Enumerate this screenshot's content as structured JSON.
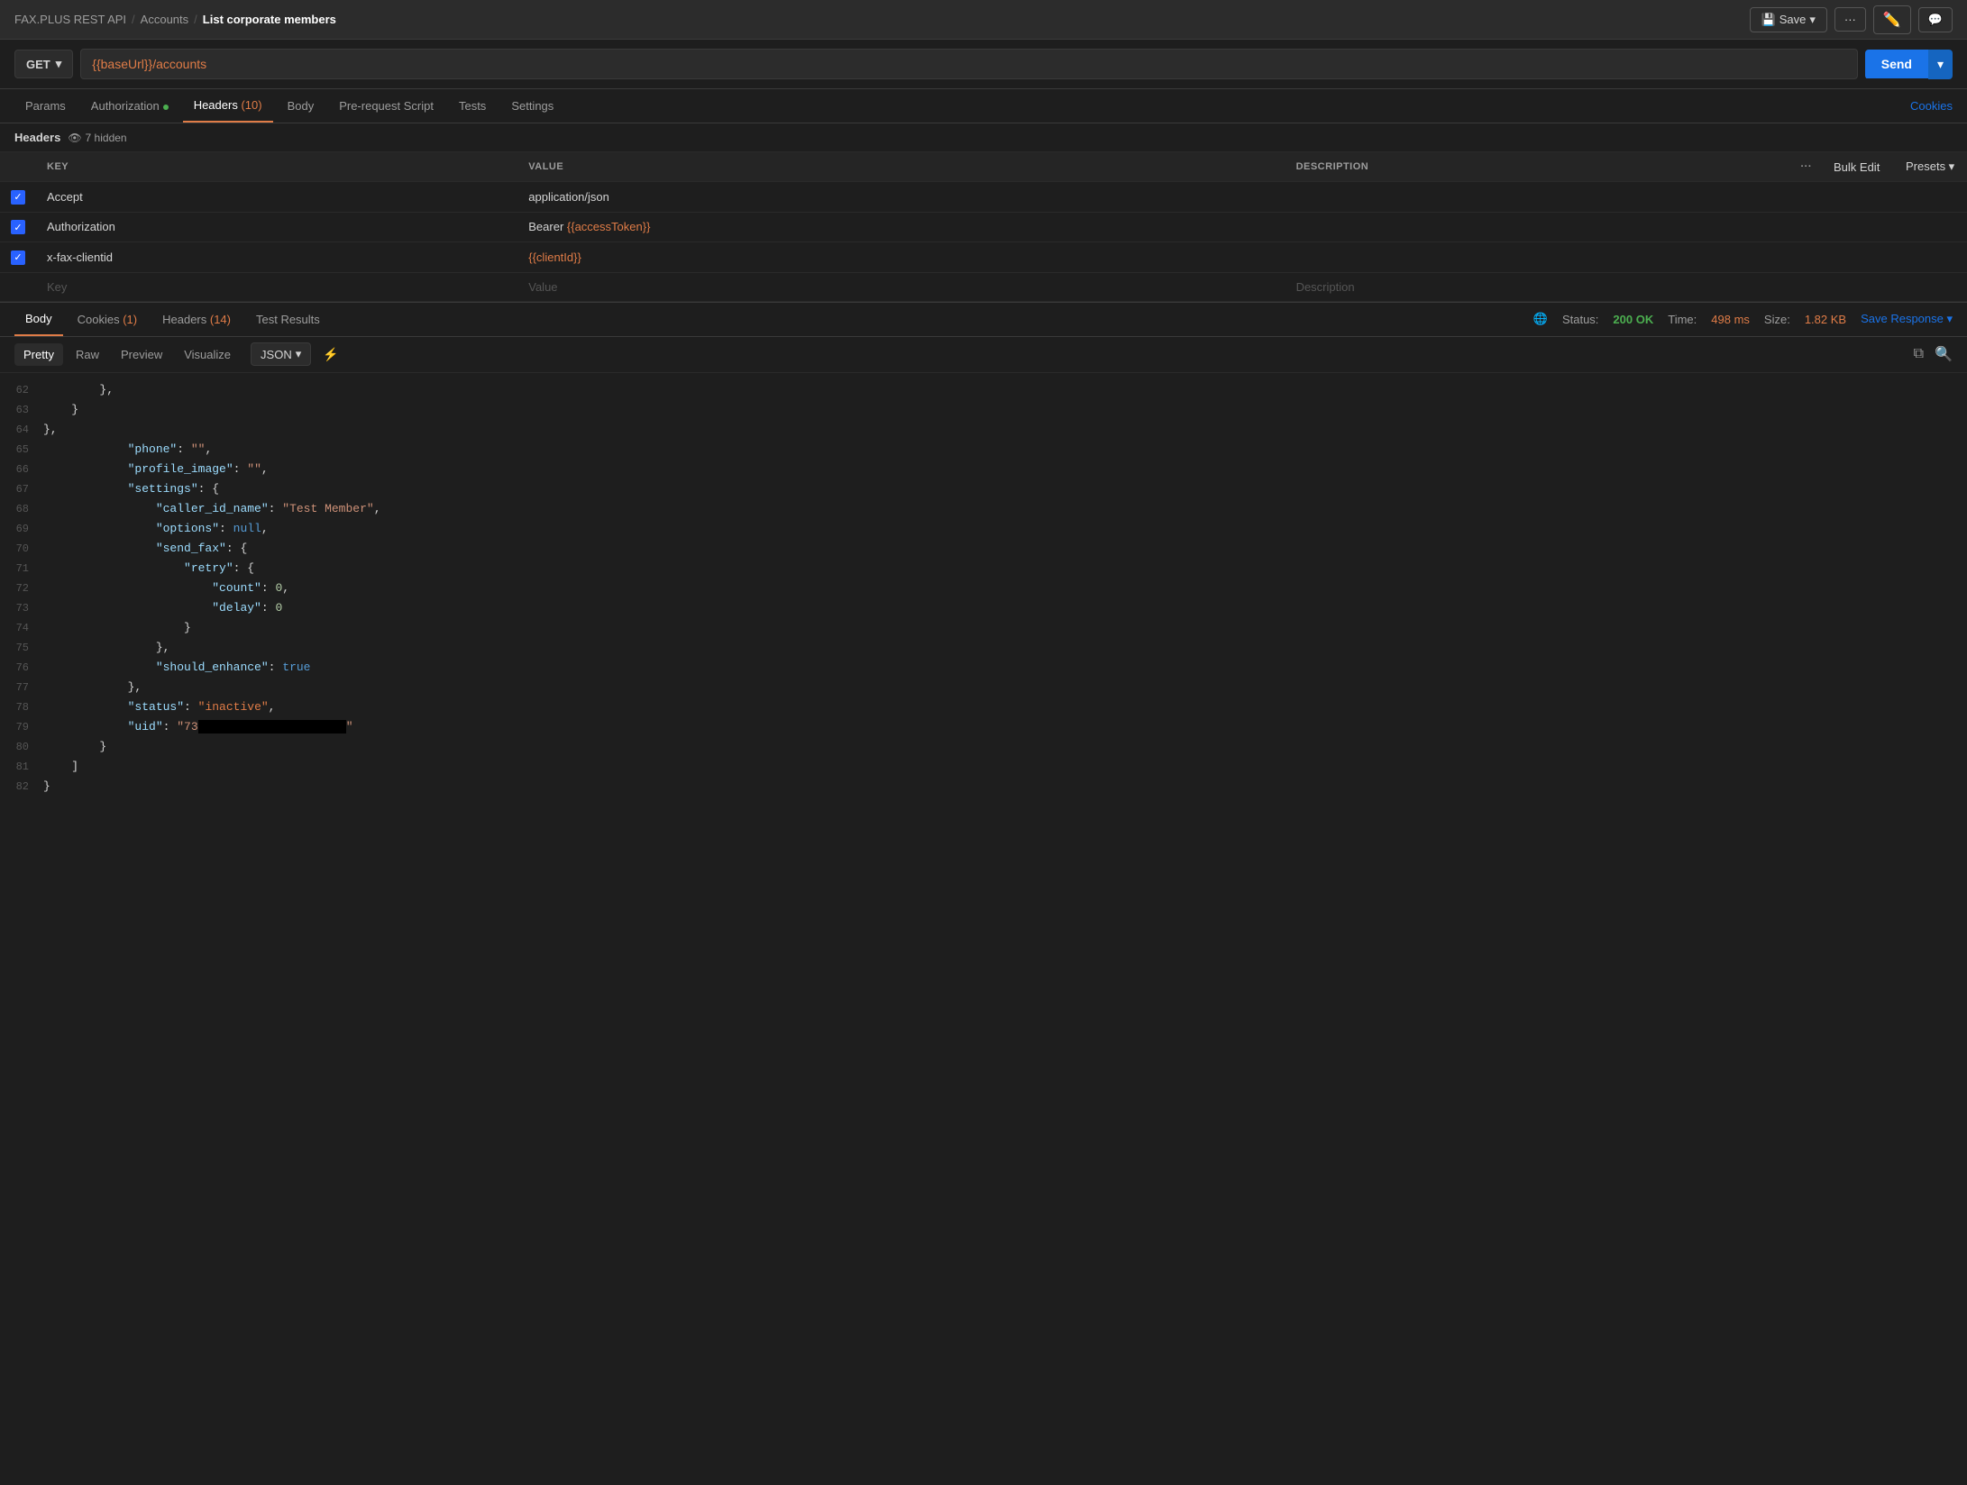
{
  "topbar": {
    "breadcrumb": [
      "FAX.PLUS REST API",
      "Accounts",
      "List corporate members"
    ],
    "save_label": "Save",
    "more_label": "···"
  },
  "urlbar": {
    "method": "GET",
    "url": "{{baseUrl}}/accounts",
    "send_label": "Send"
  },
  "request_tabs": [
    {
      "label": "Params",
      "active": false,
      "dot": false,
      "count": null
    },
    {
      "label": "Authorization",
      "active": false,
      "dot": true,
      "count": null
    },
    {
      "label": "Headers",
      "active": true,
      "dot": false,
      "count": "10"
    },
    {
      "label": "Body",
      "active": false,
      "dot": false,
      "count": null
    },
    {
      "label": "Pre-request Script",
      "active": false,
      "dot": false,
      "count": null
    },
    {
      "label": "Tests",
      "active": false,
      "dot": false,
      "count": null
    },
    {
      "label": "Settings",
      "active": false,
      "dot": false,
      "count": null
    }
  ],
  "cookies_link": "Cookies",
  "headers_section": {
    "title": "Headers",
    "hidden_count": "7 hidden"
  },
  "table": {
    "columns": [
      "KEY",
      "VALUE",
      "DESCRIPTION"
    ],
    "bulk_edit": "Bulk Edit",
    "presets": "Presets",
    "rows": [
      {
        "checked": true,
        "key": "Accept",
        "value": "application/json",
        "value_type": "plain",
        "description": ""
      },
      {
        "checked": true,
        "key": "Authorization",
        "value": "Bearer {{accessToken}}",
        "value_type": "mixed",
        "value_plain": "Bearer ",
        "value_orange": "{{accessToken}}",
        "description": ""
      },
      {
        "checked": true,
        "key": "x-fax-clientid",
        "value": "{{clientId}}",
        "value_type": "orange",
        "description": ""
      }
    ],
    "empty_row": {
      "key_placeholder": "Key",
      "value_placeholder": "Value",
      "desc_placeholder": "Description"
    }
  },
  "response_tabs": [
    {
      "label": "Body",
      "active": true,
      "count": null
    },
    {
      "label": "Cookies",
      "active": false,
      "count": "1"
    },
    {
      "label": "Headers",
      "active": false,
      "count": "14"
    },
    {
      "label": "Test Results",
      "active": false,
      "count": null
    }
  ],
  "response_status": {
    "label_status": "Status:",
    "status_code": "200 OK",
    "label_time": "Time:",
    "time_val": "498 ms",
    "label_size": "Size:",
    "size_val": "1.82 KB",
    "save_response": "Save Response"
  },
  "format_bar": {
    "tabs": [
      "Pretty",
      "Raw",
      "Preview",
      "Visualize"
    ],
    "active_tab": "Pretty",
    "format": "JSON"
  },
  "code_lines": [
    {
      "num": 62,
      "content": "        },"
    },
    {
      "num": 63,
      "content": "    }"
    },
    {
      "num": 64,
      "content": "},"
    },
    {
      "num": 65,
      "content": "\"phone\": \"\",",
      "parts": [
        {
          "text": "\"phone\"",
          "type": "key"
        },
        {
          "text": ": ",
          "type": "plain"
        },
        {
          "text": "\"\"",
          "type": "str"
        },
        {
          "text": ",",
          "type": "plain"
        }
      ]
    },
    {
      "num": 66,
      "content": "\"profile_image\": \"\",",
      "parts": [
        {
          "text": "\"profile_image\"",
          "type": "key"
        },
        {
          "text": ": ",
          "type": "plain"
        },
        {
          "text": "\"\"",
          "type": "str"
        },
        {
          "text": ",",
          "type": "plain"
        }
      ]
    },
    {
      "num": 67,
      "content": "\"settings\": {",
      "parts": [
        {
          "text": "\"settings\"",
          "type": "key"
        },
        {
          "text": ": {",
          "type": "plain"
        }
      ]
    },
    {
      "num": 68,
      "content": "    \"caller_id_name\": \"Test Member\",",
      "parts": [
        {
          "text": "    "
        },
        {
          "text": "\"caller_id_name\"",
          "type": "key"
        },
        {
          "text": ": ",
          "type": "plain"
        },
        {
          "text": "\"Test Member\"",
          "type": "str"
        },
        {
          "text": ",",
          "type": "plain"
        }
      ]
    },
    {
      "num": 69,
      "content": "    \"options\": null,",
      "parts": [
        {
          "text": "    "
        },
        {
          "text": "\"options\"",
          "type": "key"
        },
        {
          "text": ": ",
          "type": "plain"
        },
        {
          "text": "null",
          "type": "null"
        },
        {
          "text": ",",
          "type": "plain"
        }
      ]
    },
    {
      "num": 70,
      "content": "    \"send_fax\": {",
      "parts": [
        {
          "text": "    "
        },
        {
          "text": "\"send_fax\"",
          "type": "key"
        },
        {
          "text": ": {",
          "type": "plain"
        }
      ]
    },
    {
      "num": 71,
      "content": "        \"retry\": {",
      "parts": [
        {
          "text": "        "
        },
        {
          "text": "\"retry\"",
          "type": "key"
        },
        {
          "text": ": {",
          "type": "plain"
        }
      ]
    },
    {
      "num": 72,
      "content": "            \"count\": 0,",
      "parts": [
        {
          "text": "            "
        },
        {
          "text": "\"count\"",
          "type": "key"
        },
        {
          "text": ": ",
          "type": "plain"
        },
        {
          "text": "0",
          "type": "num"
        },
        {
          "text": ",",
          "type": "plain"
        }
      ]
    },
    {
      "num": 73,
      "content": "            \"delay\": 0",
      "parts": [
        {
          "text": "            "
        },
        {
          "text": "\"delay\"",
          "type": "key"
        },
        {
          "text": ": ",
          "type": "plain"
        },
        {
          "text": "0",
          "type": "num"
        }
      ]
    },
    {
      "num": 74,
      "content": "        }",
      "parts": [
        {
          "text": "        }"
        }
      ]
    },
    {
      "num": 75,
      "content": "    },",
      "parts": [
        {
          "text": "    },"
        }
      ]
    },
    {
      "num": 76,
      "content": "    \"should_enhance\": true",
      "parts": [
        {
          "text": "    "
        },
        {
          "text": "\"should_enhance\"",
          "type": "key"
        },
        {
          "text": ": ",
          "type": "plain"
        },
        {
          "text": "true",
          "type": "bool"
        }
      ]
    },
    {
      "num": 77,
      "content": "},",
      "parts": [
        {
          "text": "},"
        }
      ]
    },
    {
      "num": 78,
      "content": "\"status\": \"inactive\",",
      "parts": [
        {
          "text": "\"status\"",
          "type": "key"
        },
        {
          "text": ": ",
          "type": "plain"
        },
        {
          "text": "\"inactive\"",
          "type": "orange"
        },
        {
          "text": ",",
          "type": "plain"
        }
      ]
    },
    {
      "num": 79,
      "content": "\"uid\": \"73...\",",
      "parts": [
        {
          "text": "\"uid\"",
          "type": "key"
        },
        {
          "text": ": ",
          "type": "plain"
        },
        {
          "text": "\"73",
          "type": "str"
        },
        {
          "text": "REDACTED",
          "type": "redacted"
        },
        {
          "text": "\"",
          "type": "str"
        }
      ]
    },
    {
      "num": 80,
      "content": "    }"
    },
    {
      "num": 81,
      "content": "]"
    },
    {
      "num": 82,
      "content": "}"
    }
  ]
}
